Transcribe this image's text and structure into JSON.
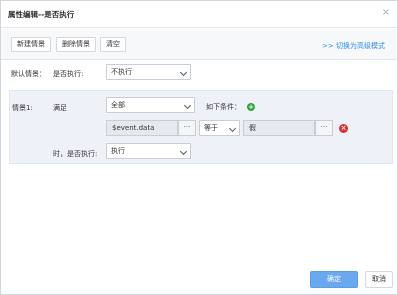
{
  "dialog": {
    "title": "属性编辑--是否执行",
    "close_glyph": "×"
  },
  "toolbar": {
    "new_scenario": "新建情景",
    "delete_scenario": "删除情景",
    "clear": "清空",
    "advanced_link": ">> 切换为高级模式"
  },
  "default": {
    "label": "默认情景：",
    "exec_label": "是否执行:",
    "exec_value": "不执行"
  },
  "scenario": {
    "label": "情景1:",
    "satisfy_label": "满足",
    "match_value": "全部",
    "conditions_label": "如下条件：",
    "condition": {
      "left": "$event.data",
      "left_dots": "···",
      "operator": "等于",
      "right": "假",
      "right_dots": "···"
    },
    "then_label": "时，是否执行:",
    "then_value": "执行"
  },
  "footer": {
    "ok": "确定",
    "cancel": "取消"
  },
  "colors": {
    "accent": "#2d8cf0",
    "ok_button": "#6aa9ef",
    "add_icon": "#2fa33a",
    "delete_icon": "#e02d2d"
  }
}
